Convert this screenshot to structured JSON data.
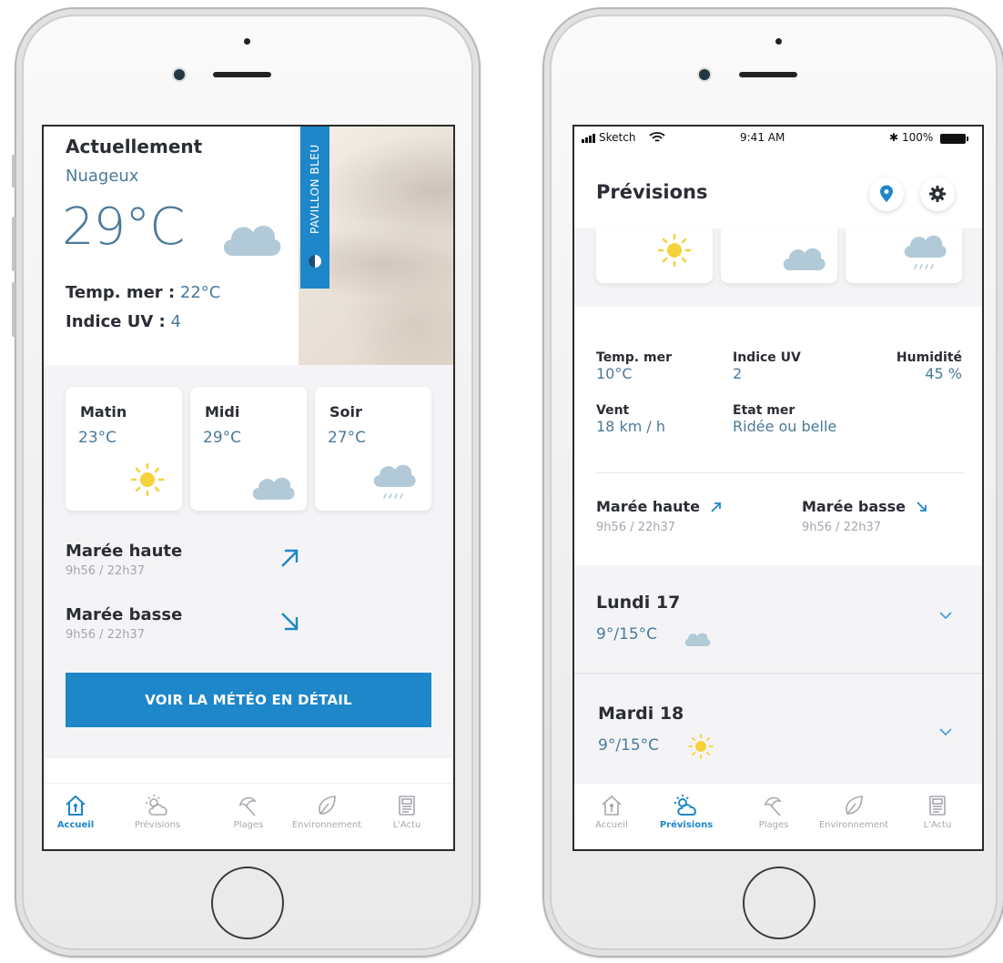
{
  "colors": {
    "accent": "#1d87c9",
    "text_dark": "#2b2d35",
    "text_blue": "#4a7a9a",
    "text_muted": "#a3a7ae",
    "band": "#f4f4f6",
    "cloud": "#b2cad8",
    "sun": "#f6d23a"
  },
  "left": {
    "header": {
      "title": "Actuellement",
      "condition": "Nuageux",
      "temperature": "29°C",
      "sea_temp_label": "Temp. mer :",
      "sea_temp_value": "22°C",
      "uv_label": "Indice UV :",
      "uv_value": "4",
      "badge": "PAVILLON BLEU",
      "weather_icon": "cloud-icon"
    },
    "periods": [
      {
        "label": "Matin",
        "temp": "23°C",
        "icon": "sun-icon"
      },
      {
        "label": "Midi",
        "temp": "29°C",
        "icon": "cloud-icon"
      },
      {
        "label": "Soir",
        "temp": "27°C",
        "icon": "rain-cloud-icon"
      }
    ],
    "tides": [
      {
        "label": "Marée haute",
        "time": "9h56 / 22h37",
        "icon": "arrow-up-right-icon"
      },
      {
        "label": "Marée basse",
        "time": "9h56 / 22h37",
        "icon": "arrow-down-right-icon"
      }
    ],
    "cta_label": "VOIR LA MÉTÉO EN DÉTAIL",
    "tabs": [
      {
        "label": "Accueil",
        "icon": "home-icon",
        "active": true
      },
      {
        "label": "Prévisions",
        "icon": "sun-cloud-icon",
        "active": false
      },
      {
        "label": "Plages",
        "icon": "parasol-icon",
        "active": false
      },
      {
        "label": "Environnement",
        "icon": "leaf-icon",
        "active": false
      },
      {
        "label": "L'Actu",
        "icon": "newspaper-icon",
        "active": false
      }
    ]
  },
  "right": {
    "status": {
      "carrier": "Sketch",
      "time": "9:41 AM",
      "battery": "100%"
    },
    "title": "Prévisions",
    "stats": {
      "sea_temp_label": "Temp. mer",
      "sea_temp_value": "10°C",
      "uv_label": "Indice UV",
      "uv_value": "2",
      "humidity_label": "Humidité",
      "humidity_value": "45 %",
      "wind_label": "Vent",
      "wind_value": "18 km / h",
      "sea_state_label": "Etat mer",
      "sea_state_value": "Ridée ou belle"
    },
    "tides": [
      {
        "label": "Marée haute",
        "time": "9h56 / 22h37",
        "icon": "arrow-up-right-icon"
      },
      {
        "label": "Marée basse",
        "time": "9h56 / 22h37",
        "icon": "arrow-down-right-icon"
      }
    ],
    "days": [
      {
        "name": "Lundi 17",
        "temps": "9°/15°C",
        "icon": "cloud-icon"
      },
      {
        "name": "Mardi 18",
        "temps": "9°/15°C",
        "icon": "sun-icon"
      }
    ],
    "tabs": [
      {
        "label": "Accueil",
        "icon": "home-icon",
        "active": false
      },
      {
        "label": "Prévisions",
        "icon": "sun-cloud-icon",
        "active": true
      },
      {
        "label": "Plages",
        "icon": "parasol-icon",
        "active": false
      },
      {
        "label": "Environnement",
        "icon": "leaf-icon",
        "active": false
      },
      {
        "label": "L'Actu",
        "icon": "newspaper-icon",
        "active": false
      }
    ]
  }
}
